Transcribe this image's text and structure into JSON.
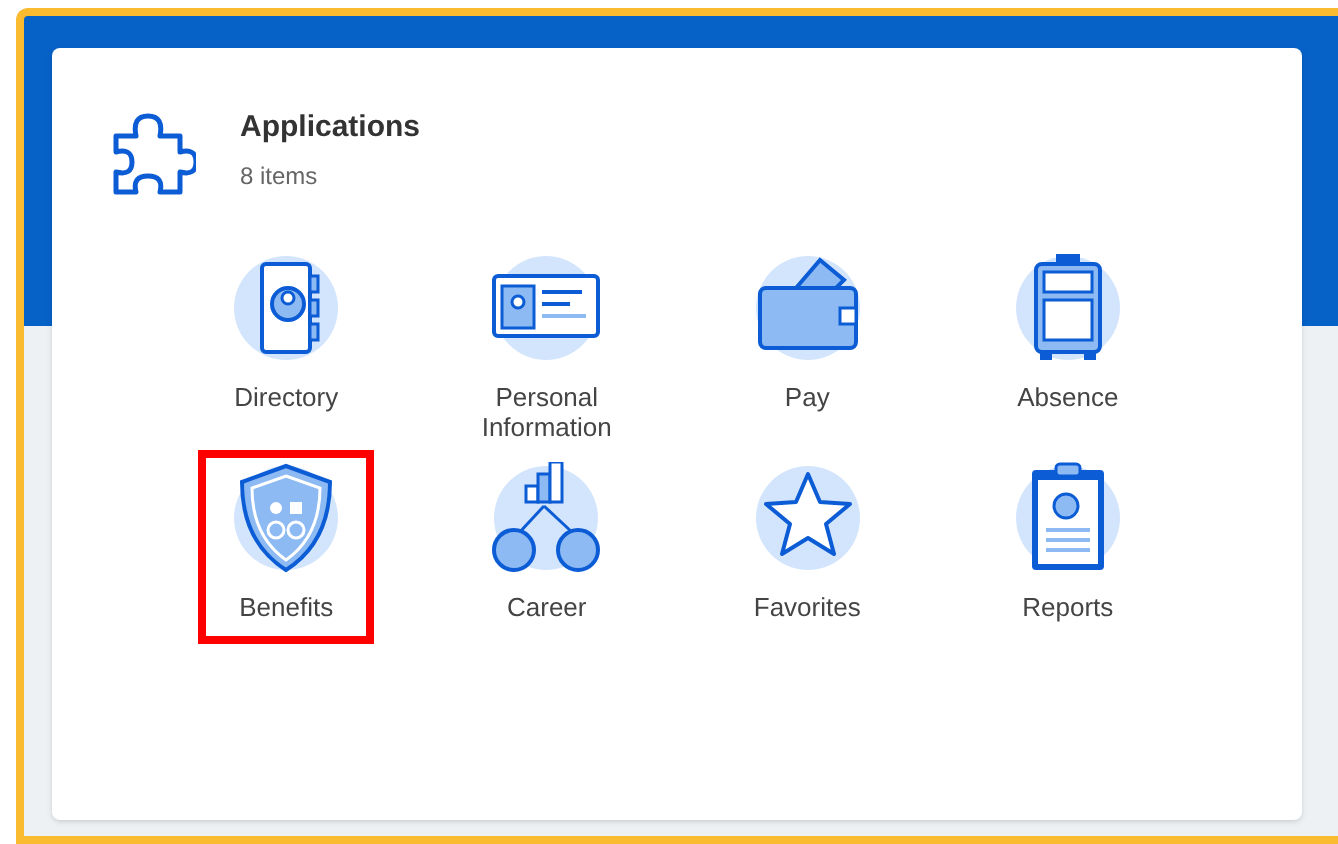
{
  "card": {
    "title": "Applications",
    "subtitle": "8 items"
  },
  "apps": [
    {
      "label": "Directory",
      "selected": false
    },
    {
      "label": "Personal Information",
      "selected": false
    },
    {
      "label": "Pay",
      "selected": false
    },
    {
      "label": "Absence",
      "selected": false
    },
    {
      "label": "Benefits",
      "selected": true
    },
    {
      "label": "Career",
      "selected": false
    },
    {
      "label": "Favorites",
      "selected": false
    },
    {
      "label": "Reports",
      "selected": false
    }
  ]
}
